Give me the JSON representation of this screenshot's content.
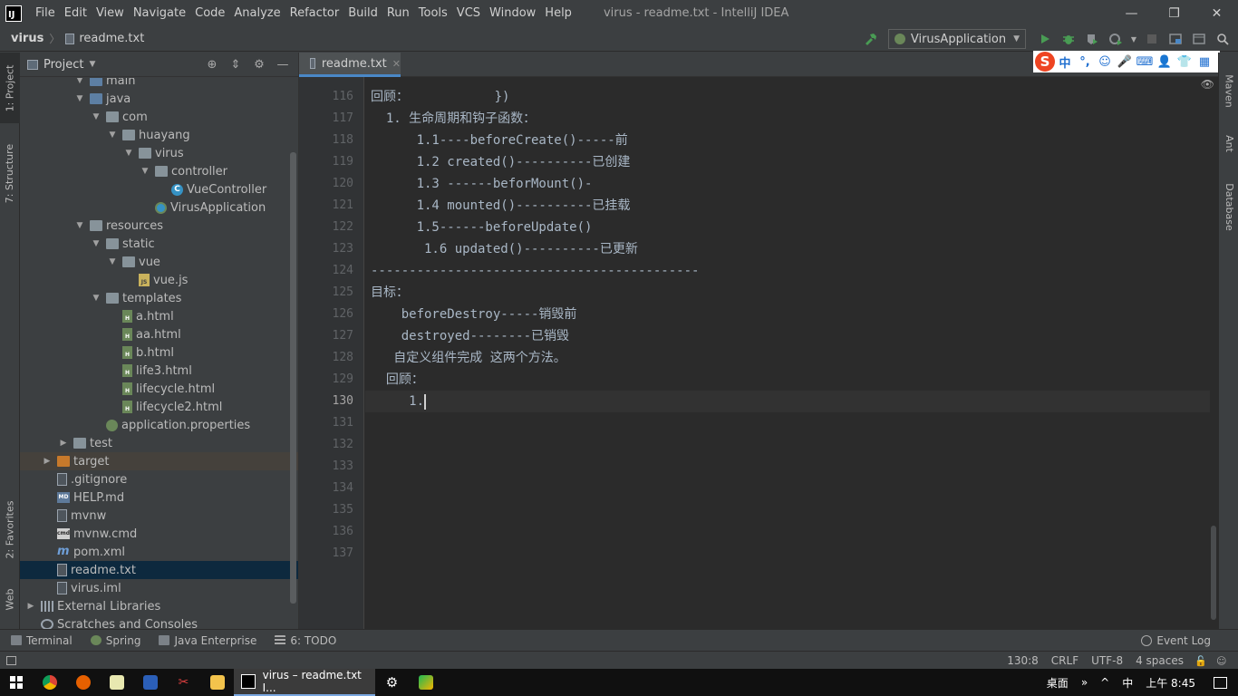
{
  "app": {
    "logo_text": "IJ",
    "window_title": "virus - readme.txt - IntelliJ IDEA"
  },
  "menu": [
    "File",
    "Edit",
    "View",
    "Navigate",
    "Code",
    "Analyze",
    "Refactor",
    "Build",
    "Run",
    "Tools",
    "VCS",
    "Window",
    "Help"
  ],
  "window_controls": {
    "minimize": "—",
    "maximize": "❐",
    "close": "✕"
  },
  "breadcrumb": {
    "project": "virus",
    "separator": "〉",
    "file": "readme.txt"
  },
  "toolbar": {
    "run_config": "VirusApplication"
  },
  "left_stripe": {
    "project": "1: Project",
    "structure": "7: Structure",
    "favorites": "2: Favorites",
    "web": "Web"
  },
  "right_stripe": {
    "maven": "Maven",
    "ant": "Ant",
    "database": "Database"
  },
  "project_panel": {
    "title": "Project",
    "tree": [
      {
        "label": "main",
        "depth": 3,
        "arrow": "down",
        "icon": "folder-src"
      },
      {
        "label": "java",
        "depth": 3,
        "arrow": "down",
        "icon": "folder-src"
      },
      {
        "label": "com",
        "depth": 4,
        "arrow": "down",
        "icon": "package"
      },
      {
        "label": "huayang",
        "depth": 5,
        "arrow": "down",
        "icon": "package"
      },
      {
        "label": "virus",
        "depth": 6,
        "arrow": "down",
        "icon": "package"
      },
      {
        "label": "controller",
        "depth": 7,
        "arrow": "down",
        "icon": "package"
      },
      {
        "label": "VueController",
        "depth": 8,
        "arrow": "none",
        "icon": "class"
      },
      {
        "label": "VirusApplication",
        "depth": 7,
        "arrow": "none",
        "icon": "spring"
      },
      {
        "label": "resources",
        "depth": 3,
        "arrow": "down",
        "icon": "folder"
      },
      {
        "label": "static",
        "depth": 4,
        "arrow": "down",
        "icon": "folder"
      },
      {
        "label": "vue",
        "depth": 5,
        "arrow": "down",
        "icon": "folder"
      },
      {
        "label": "vue.js",
        "depth": 6,
        "arrow": "none",
        "icon": "js"
      },
      {
        "label": "templates",
        "depth": 4,
        "arrow": "down",
        "icon": "folder"
      },
      {
        "label": "a.html",
        "depth": 5,
        "arrow": "none",
        "icon": "html"
      },
      {
        "label": "aa.html",
        "depth": 5,
        "arrow": "none",
        "icon": "html"
      },
      {
        "label": "b.html",
        "depth": 5,
        "arrow": "none",
        "icon": "html"
      },
      {
        "label": "life3.html",
        "depth": 5,
        "arrow": "none",
        "icon": "html"
      },
      {
        "label": "lifecycle.html",
        "depth": 5,
        "arrow": "none",
        "icon": "html"
      },
      {
        "label": "lifecycle2.html",
        "depth": 5,
        "arrow": "none",
        "icon": "html"
      },
      {
        "label": "application.properties",
        "depth": 4,
        "arrow": "none",
        "icon": "props"
      },
      {
        "label": "test",
        "depth": 2,
        "arrow": "right",
        "icon": "folder"
      },
      {
        "label": "target",
        "depth": 1,
        "arrow": "right",
        "icon": "folder-orange",
        "state": "excluded"
      },
      {
        "label": ".gitignore",
        "depth": 1,
        "arrow": "none",
        "icon": "file"
      },
      {
        "label": "HELP.md",
        "depth": 1,
        "arrow": "none",
        "icon": "md"
      },
      {
        "label": "mvnw",
        "depth": 1,
        "arrow": "none",
        "icon": "file"
      },
      {
        "label": "mvnw.cmd",
        "depth": 1,
        "arrow": "none",
        "icon": "cmd"
      },
      {
        "label": "pom.xml",
        "depth": 1,
        "arrow": "none",
        "icon": "maven"
      },
      {
        "label": "readme.txt",
        "depth": 1,
        "arrow": "none",
        "icon": "file",
        "state": "selected"
      },
      {
        "label": "virus.iml",
        "depth": 1,
        "arrow": "none",
        "icon": "file"
      },
      {
        "label": "External Libraries",
        "depth": 0,
        "arrow": "right",
        "icon": "libs"
      },
      {
        "label": "Scratches and Consoles",
        "depth": 0,
        "arrow": "none",
        "icon": "scratch"
      }
    ]
  },
  "editor": {
    "tab": {
      "label": "readme.txt",
      "close": "✕"
    },
    "partial_top_text": "})",
    "lines": [
      {
        "no": "116",
        "text": "回顾："
      },
      {
        "no": "117",
        "text": "  1. 生命周期和钩子函数："
      },
      {
        "no": "118",
        "text": "      1.1----beforeCreate()-----前"
      },
      {
        "no": "119",
        "text": "      1.2 created()----------已创建"
      },
      {
        "no": "120",
        "text": "      1.3 ------beforMount()-"
      },
      {
        "no": "121",
        "text": "      1.4 mounted()----------已挂载"
      },
      {
        "no": "122",
        "text": "      1.5------beforeUpdate()"
      },
      {
        "no": "123",
        "text": "       1.6 updated()----------已更新"
      },
      {
        "no": "124",
        "text": "-------------------------------------------"
      },
      {
        "no": "125",
        "text": "目标："
      },
      {
        "no": "126",
        "text": "    beforeDestroy-----销毁前"
      },
      {
        "no": "127",
        "text": "    destroyed--------已销毁"
      },
      {
        "no": "128",
        "text": "   自定义组件完成 这两个方法。"
      },
      {
        "no": "129",
        "text": "  回顾："
      },
      {
        "no": "130",
        "text": "     1.",
        "current": true
      },
      {
        "no": "131",
        "text": ""
      },
      {
        "no": "132",
        "text": ""
      },
      {
        "no": "133",
        "text": ""
      },
      {
        "no": "134",
        "text": ""
      },
      {
        "no": "135",
        "text": ""
      },
      {
        "no": "136",
        "text": ""
      },
      {
        "no": "137",
        "text": ""
      }
    ]
  },
  "ime_toolbar": {
    "logo": "S",
    "items": [
      "中",
      "°,",
      "☺",
      "🎤",
      "⌨",
      "👤",
      "👕",
      "▦"
    ]
  },
  "bottom_tools": [
    "Terminal",
    "Spring",
    "Java Enterprise",
    "6: TODO"
  ],
  "event_log": "Event Log",
  "status": {
    "position": "130:8",
    "line_sep": "CRLF",
    "encoding": "UTF-8",
    "indent": "4 spaces"
  },
  "taskbar": {
    "active_task": "virus – readme.txt I...",
    "tray": {
      "desktop": "桌面",
      "chevron": "»",
      "up": "^",
      "lang": "中",
      "time": "上午 8:45"
    }
  },
  "colors": {
    "accent": "#4a88c7",
    "selection": "#0d293e",
    "editor_bg": "#2b2b2b",
    "panel_bg": "#3c3f41",
    "run_green": "#499c54"
  }
}
